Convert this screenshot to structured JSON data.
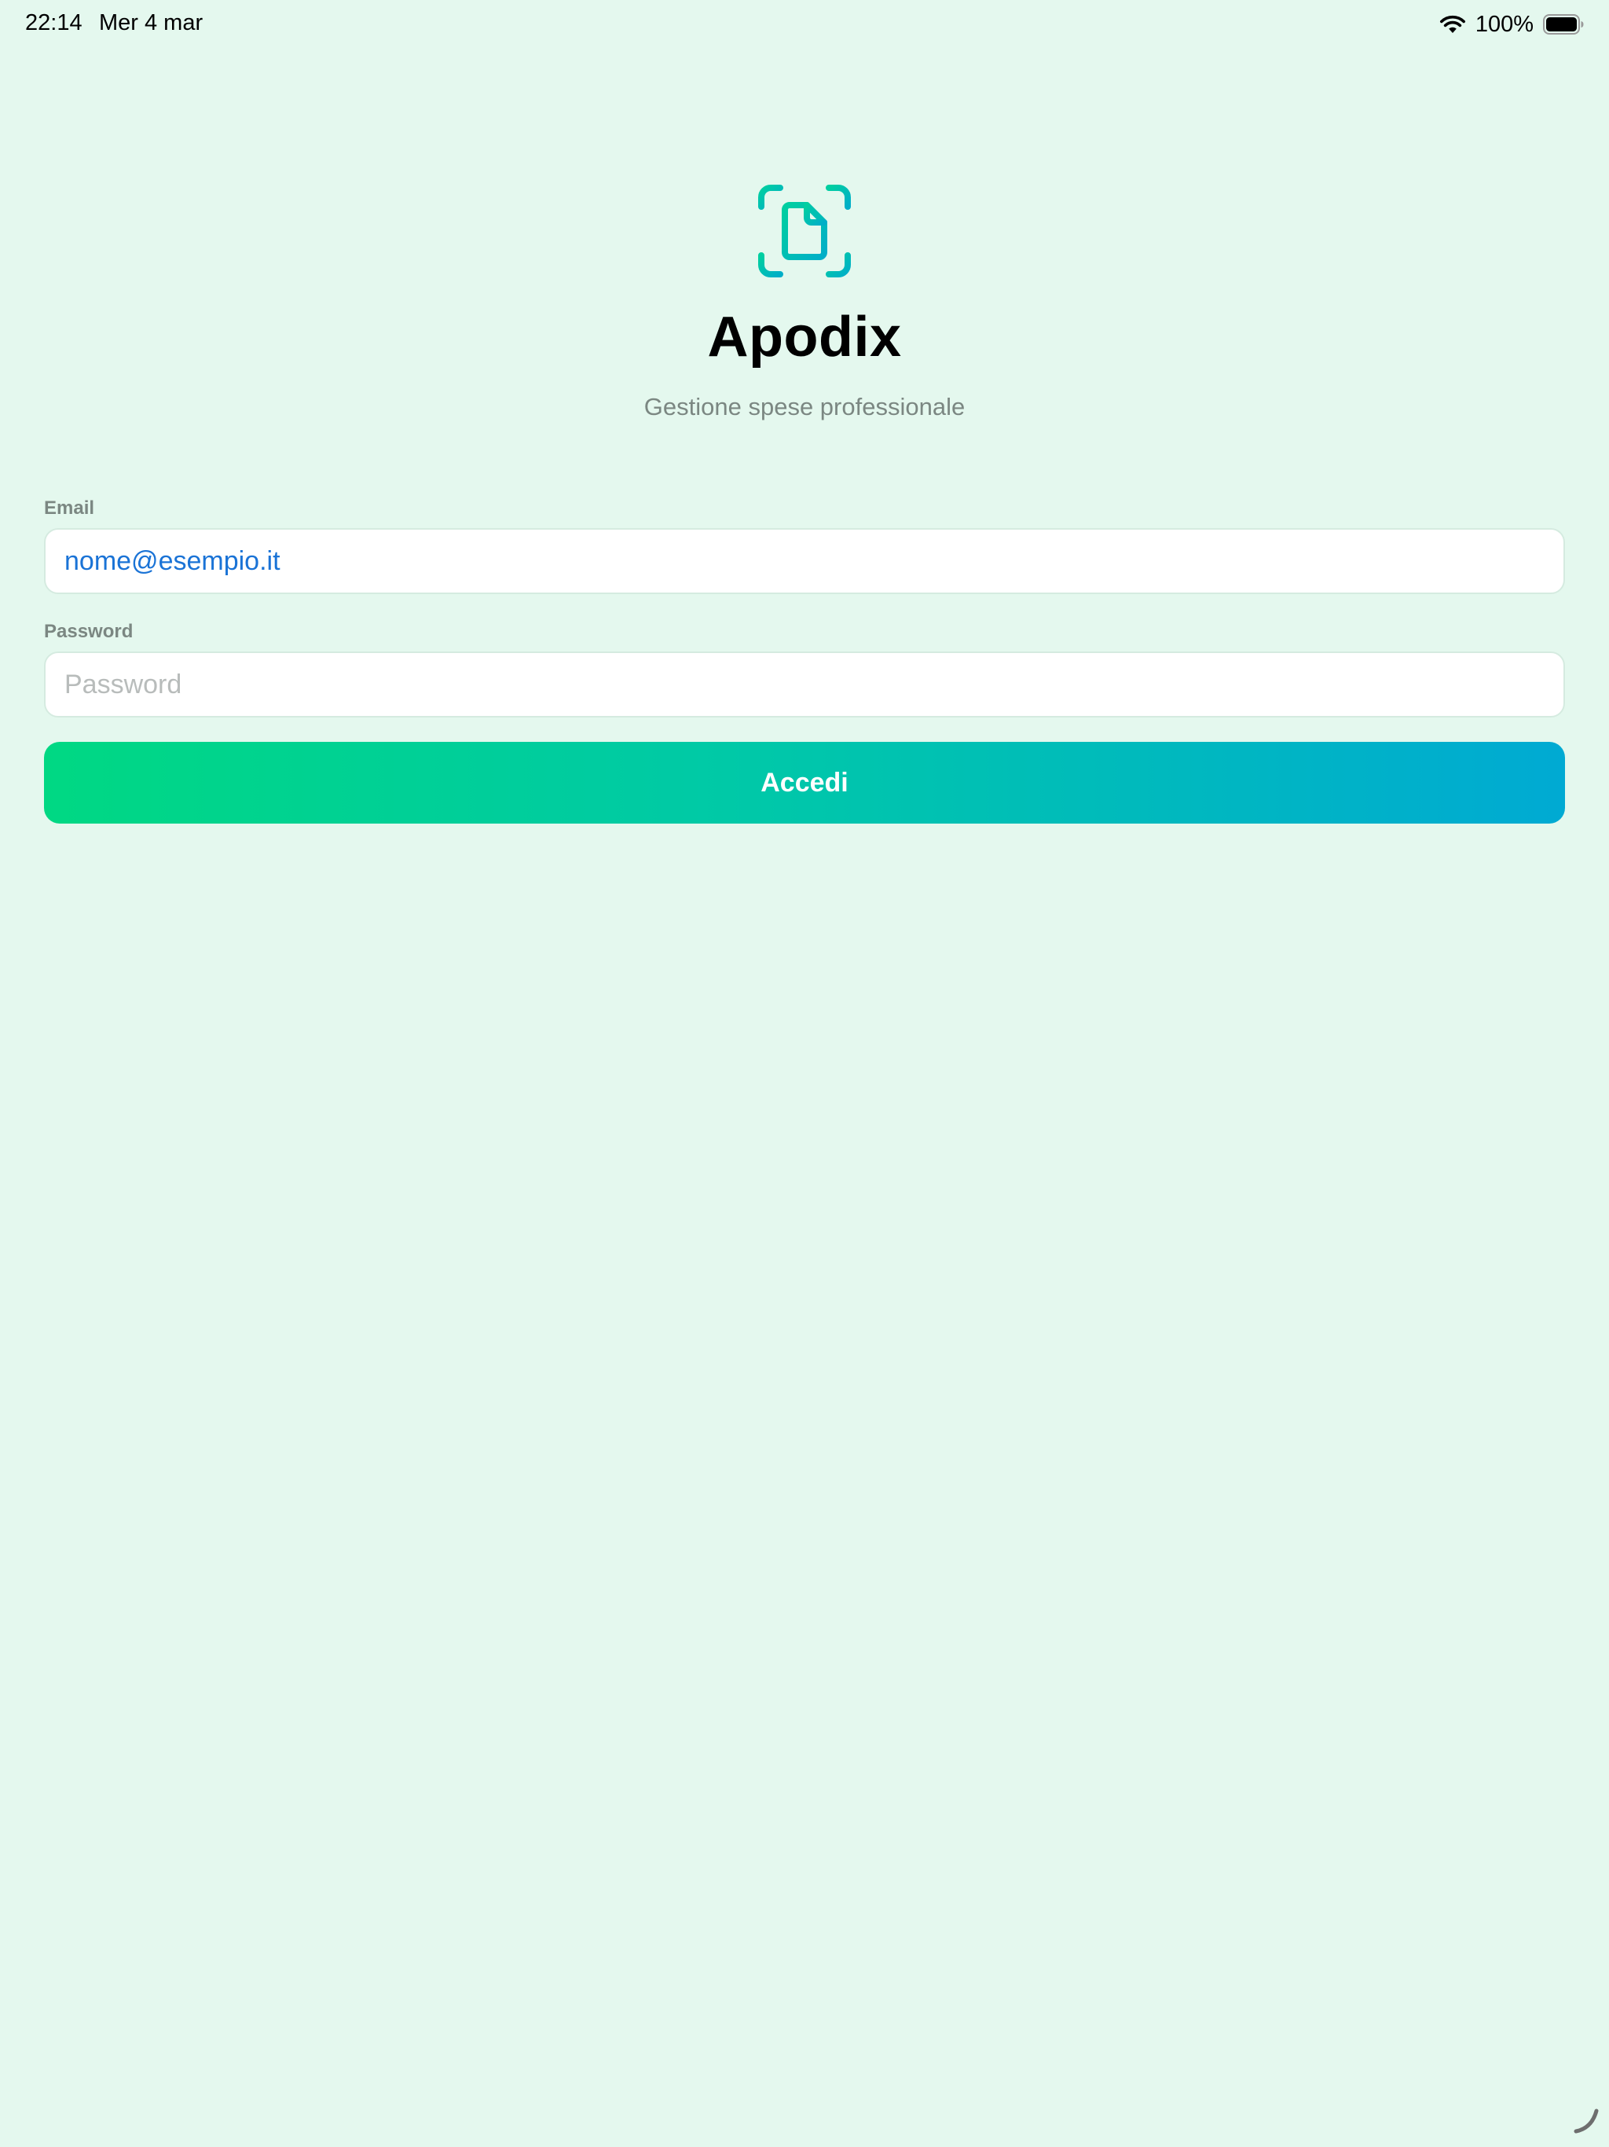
{
  "status_bar": {
    "time": "22:14",
    "date": "Mer 4 mar",
    "battery": "100%",
    "wifi_icon": "wifi-icon",
    "battery_icon": "battery-icon"
  },
  "header": {
    "logo_icon": "document-scan-icon",
    "title": "Apodix",
    "subtitle": "Gestione spese professionale"
  },
  "form": {
    "email": {
      "label": "Email",
      "value": "nome@esempio.it",
      "placeholder": "",
      "value_color": "#1a73d6"
    },
    "password": {
      "label": "Password",
      "value": "",
      "placeholder": "Password"
    },
    "submit_label": "Accedi"
  },
  "colors": {
    "background": "#e4f8ee",
    "accent_start": "#00d883",
    "accent_end": "#00aad3",
    "muted_text": "#7b8782"
  }
}
